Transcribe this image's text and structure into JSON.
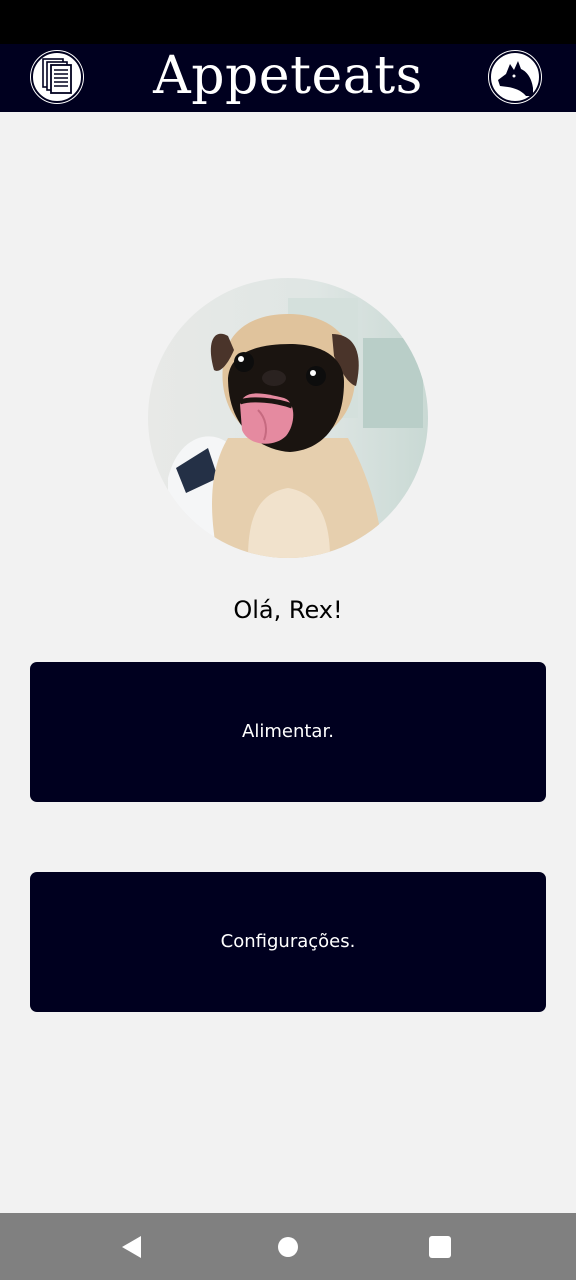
{
  "app": {
    "title": "Appeteats"
  },
  "header": {
    "menu_icon": "document-stack-icon",
    "profile_icon": "dog-head-icon"
  },
  "pet": {
    "photo": "pug-photo",
    "greeting": "Olá, Rex!"
  },
  "actions": {
    "feed_label": "Alimentar.",
    "settings_label": "Configurações."
  },
  "navigation": {
    "back_icon": "back-triangle-icon",
    "home_icon": "home-circle-icon",
    "recents_icon": "recents-square-icon"
  },
  "colors": {
    "app_bar": "#00001f",
    "status_bar": "#000000",
    "background": "#f2f2f2",
    "button": "#00001f",
    "button_text": "#ffffff",
    "nav_bar": "#808080"
  }
}
